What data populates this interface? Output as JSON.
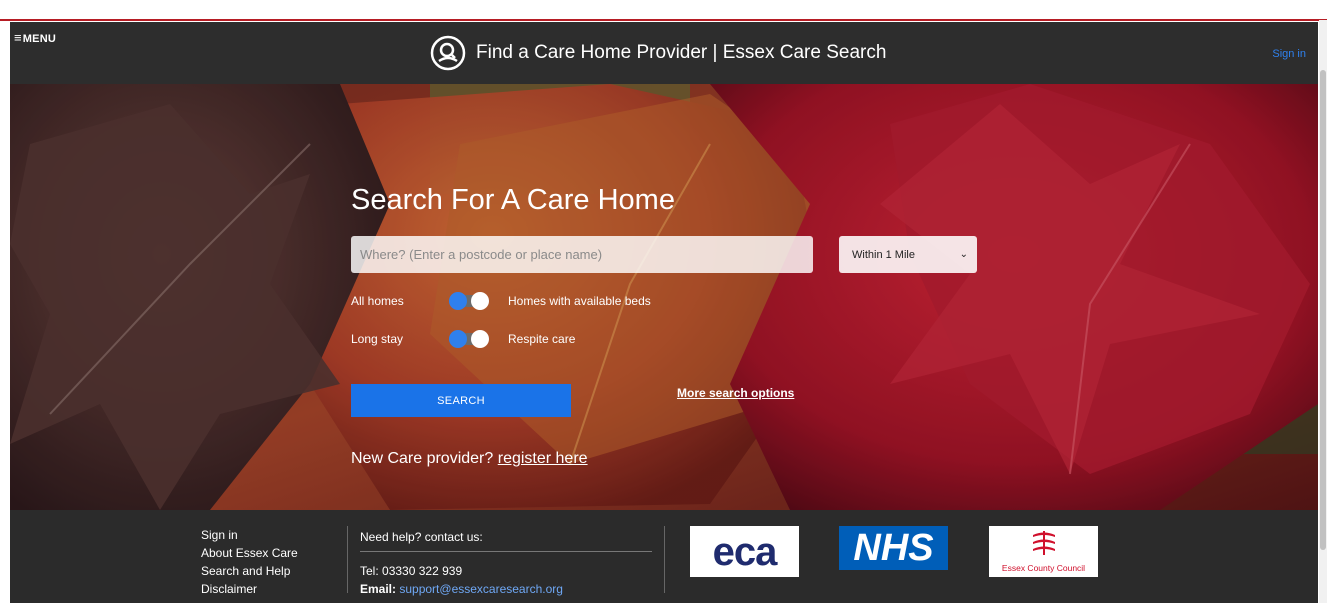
{
  "header": {
    "menu_label": "MENU",
    "site_title": "Find a Care Home Provider | Essex Care Search",
    "signin_label": "Sign in"
  },
  "search": {
    "heading": "Search For A Care Home",
    "where_placeholder": "Where? (Enter a postcode or place name)",
    "where_value": "",
    "radius_selected": "Within 1 Mile",
    "toggle_beds": {
      "left_label": "All homes",
      "right_label": "Homes with available beds"
    },
    "toggle_stay": {
      "left_label": "Long stay",
      "right_label": "Respite care"
    },
    "search_button": "SEARCH",
    "more_options_link": "More search options",
    "new_provider_prefix": "New Care provider?",
    "register_link": "register here"
  },
  "footer": {
    "links": [
      "Sign in",
      "About Essex Care",
      "Search and Help",
      "Disclaimer"
    ],
    "help_heading": "Need help? contact us:",
    "tel_label": "Tel:",
    "tel_value": "03330 322 939",
    "email_label": "Email:",
    "email_value": "support@essexcaresearch.org",
    "logos": {
      "eca": "eca",
      "nhs": "NHS",
      "ecc": "Essex County Council"
    }
  },
  "colors": {
    "accent_blue": "#1a73e8",
    "topbar_bg": "#2d2d2d",
    "link_blue": "#2f80ed",
    "nhs_blue": "#005eb8",
    "ecc_red": "#d0102c"
  }
}
